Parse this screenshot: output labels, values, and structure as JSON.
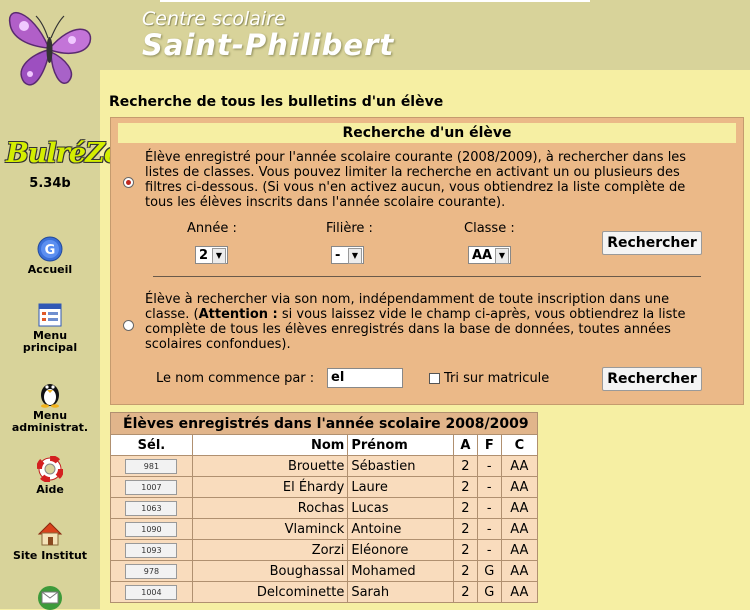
{
  "header": {
    "school_line1": "Centre scolaire",
    "school_line2": "Saint-Philibert"
  },
  "app": {
    "logo_text": "BulréZo",
    "version": "5.34b"
  },
  "nav": [
    {
      "label": "Accueil",
      "icon": "google-icon"
    },
    {
      "label": "Menu principal",
      "icon": "menu-icon"
    },
    {
      "label": "Menu administrat.",
      "icon": "penguin-icon"
    },
    {
      "label": "Aide",
      "icon": "lifebuoy-icon"
    },
    {
      "label": "Site Institut",
      "icon": "house-icon"
    },
    {
      "label": "",
      "icon": "mail-icon"
    }
  ],
  "page_title": "Recherche de tous les bulletins d'un élève",
  "panel": {
    "heading": "Recherche d'un élève",
    "option1_text": "Élève enregistré pour l'année scolaire courante (2008/2009), à rechercher dans les listes de classes. Vous pouvez limiter la recherche en activant un ou plusieurs des filtres ci-dessous. (Si vous n'en activez aucun, vous obtiendrez la liste complète de tous les élèves inscrits dans l'année scolaire courante).",
    "filters": {
      "annee_label": "Année :",
      "annee_value": "2",
      "filiere_label": "Filière :",
      "filiere_value": "-",
      "classe_label": "Classe :",
      "classe_value": "AA"
    },
    "search_button": "Rechercher",
    "option2_pre": "Élève à rechercher via son nom, indépendamment de toute inscription dans une classe. (",
    "option2_bold": "Attention :",
    "option2_post": " si vous laissez vide le champ ci-après, vous obtiendrez la liste complète de tous les élèves enregistrés dans la base de données, toutes années scolaires confondues).",
    "name_label": "Le nom commence par :",
    "name_value": "el",
    "tri_label": "Tri sur matricule",
    "selected_option": 1
  },
  "results": {
    "caption": "Élèves enregistrés dans l'année scolaire 2008/2009",
    "columns": [
      "Sél.",
      "Nom",
      "Prénom",
      "A",
      "F",
      "C"
    ],
    "rows": [
      {
        "id": "981",
        "nom": "Brouette",
        "prenom": "Sébastien",
        "a": "2",
        "f": "-",
        "c": "AA"
      },
      {
        "id": "1007",
        "nom": "El Éhardy",
        "prenom": "Laure",
        "a": "2",
        "f": "-",
        "c": "AA"
      },
      {
        "id": "1063",
        "nom": "Rochas",
        "prenom": "Lucas",
        "a": "2",
        "f": "-",
        "c": "AA"
      },
      {
        "id": "1090",
        "nom": "Vlaminck",
        "prenom": "Antoine",
        "a": "2",
        "f": "-",
        "c": "AA"
      },
      {
        "id": "1093",
        "nom": "Zorzi",
        "prenom": "Eléonore",
        "a": "2",
        "f": "-",
        "c": "AA"
      },
      {
        "id": "978",
        "nom": "Boughassal",
        "prenom": "Mohamed",
        "a": "2",
        "f": "G",
        "c": "AA"
      },
      {
        "id": "1004",
        "nom": "Delcominette",
        "prenom": "Sarah",
        "a": "2",
        "f": "G",
        "c": "AA"
      }
    ]
  }
}
